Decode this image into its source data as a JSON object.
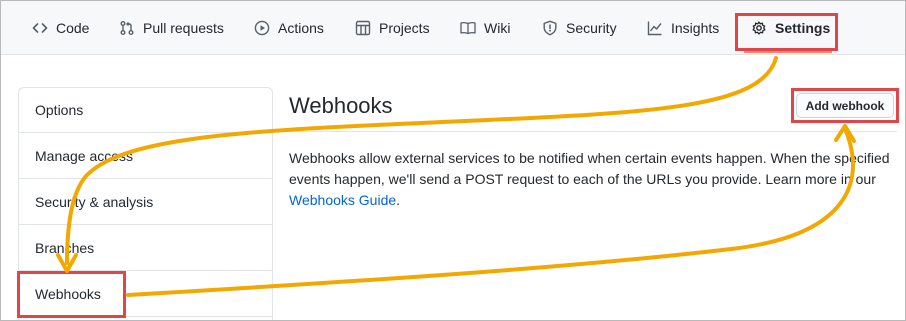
{
  "nav": {
    "tabs": [
      {
        "label": "Code",
        "icon": "code-icon"
      },
      {
        "label": "Pull requests",
        "icon": "pull-request-icon"
      },
      {
        "label": "Actions",
        "icon": "play-icon"
      },
      {
        "label": "Projects",
        "icon": "project-icon"
      },
      {
        "label": "Wiki",
        "icon": "book-icon"
      },
      {
        "label": "Security",
        "icon": "shield-icon"
      },
      {
        "label": "Insights",
        "icon": "graph-icon"
      },
      {
        "label": "Settings",
        "icon": "gear-icon",
        "active": true
      }
    ]
  },
  "sidebar": {
    "items": [
      {
        "label": "Options"
      },
      {
        "label": "Manage access"
      },
      {
        "label": "Security & analysis"
      },
      {
        "label": "Branches"
      },
      {
        "label": "Webhooks",
        "selected": true
      }
    ]
  },
  "main": {
    "title": "Webhooks",
    "add_button": "Add webhook",
    "description": "Webhooks allow external services to be notified when certain events happen. When the specified events happen, we'll send a POST request to each of the URLs you provide. Learn more in our",
    "guide_link": "Webhooks Guide",
    "description_end": "."
  },
  "colors": {
    "highlight_box": "#e0454a",
    "annotation_arrow": "#f2a800",
    "link": "#0366d6",
    "tab_underline": "#f9826c"
  }
}
